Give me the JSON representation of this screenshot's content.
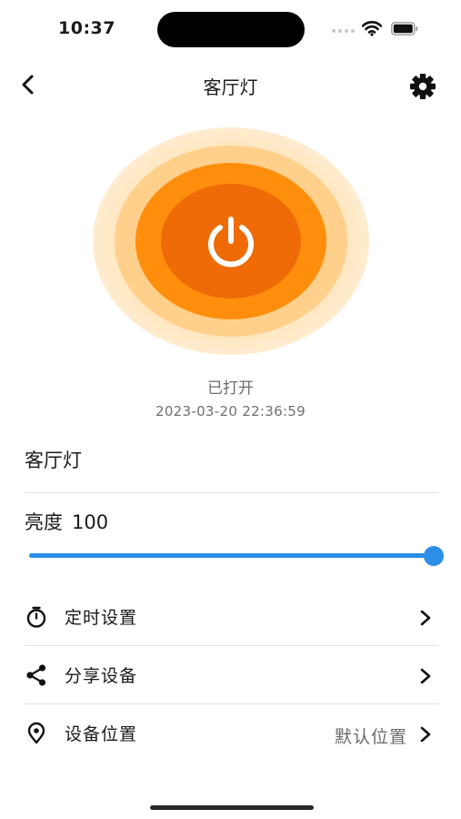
{
  "status_bar": {
    "time": "10:37"
  },
  "nav": {
    "back_icon": "chevron-left-icon",
    "title": "客厅灯",
    "settings_icon": "gear-icon"
  },
  "power": {
    "icon": "power-icon",
    "state": "已打开",
    "timestamp": "2023-03-20 22:36:59",
    "accent": "#ee6b07"
  },
  "device": {
    "name": "客厅灯"
  },
  "brightness": {
    "label": "亮度",
    "value": "100",
    "max": 100,
    "accent": "#2b8fe6"
  },
  "menu": [
    {
      "icon": "timer-icon",
      "label": "定时设置",
      "value": ""
    },
    {
      "icon": "share-icon",
      "label": "分享设备",
      "value": ""
    },
    {
      "icon": "location-pin-icon",
      "label": "设备位置",
      "value": "默认位置"
    }
  ]
}
